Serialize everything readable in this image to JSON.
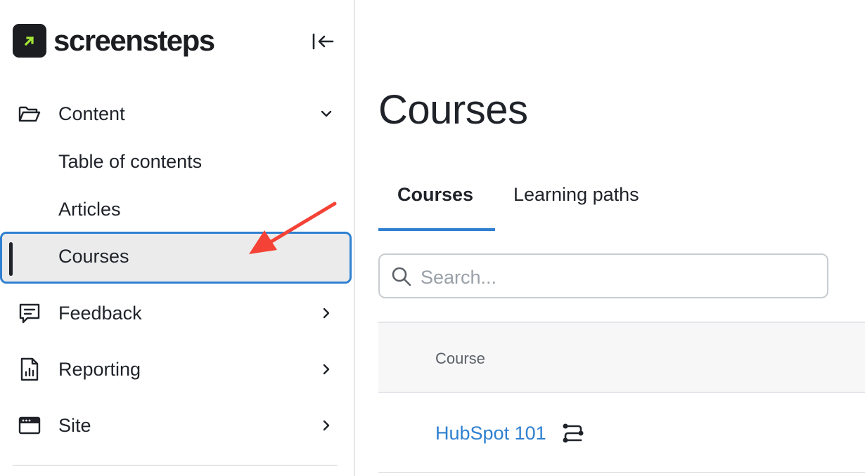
{
  "brand": {
    "name": "screensteps",
    "accent": "#a3e635"
  },
  "sidebar": {
    "collapse_icon": "collapse-left-icon",
    "sections": [
      {
        "label": "Content",
        "icon": "folder-open-icon",
        "chevron": "chevron-down-icon"
      },
      {
        "label": "Feedback",
        "icon": "chat-message-icon",
        "chevron": "chevron-right-icon"
      },
      {
        "label": "Reporting",
        "icon": "report-chart-icon",
        "chevron": "chevron-right-icon"
      },
      {
        "label": "Site",
        "icon": "browser-window-icon",
        "chevron": "chevron-right-icon"
      }
    ],
    "content_items": [
      {
        "label": "Table of contents"
      },
      {
        "label": "Articles"
      },
      {
        "label": "Courses",
        "active": true
      }
    ]
  },
  "main": {
    "title": "Courses",
    "tabs": [
      {
        "label": "Courses",
        "active": true
      },
      {
        "label": "Learning paths",
        "active": false
      }
    ],
    "search": {
      "placeholder": "Search...",
      "value": ""
    },
    "table": {
      "columns": [
        "Course"
      ],
      "rows": [
        {
          "course": "HubSpot 101",
          "icon": "learning-path-icon"
        }
      ]
    }
  },
  "colors": {
    "active_border": "#2f80d0",
    "link": "#2f80d0",
    "annotation": "#f44336"
  }
}
